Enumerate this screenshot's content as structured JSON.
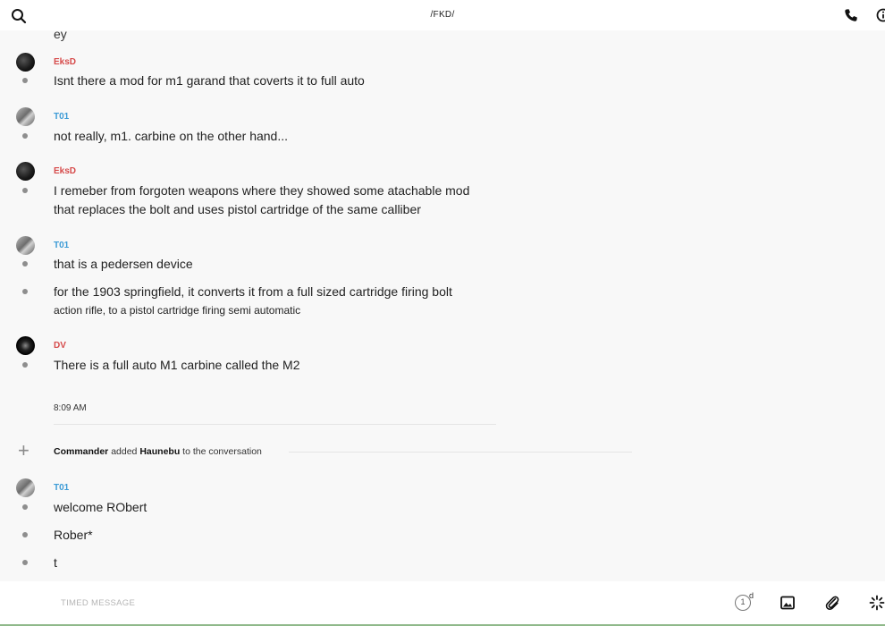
{
  "header": {
    "title": "/FKD/",
    "icons": [
      "search-icon",
      "phone-icon",
      "info-icon"
    ]
  },
  "messages": {
    "cut_top": "ey",
    "g1": {
      "sender": "EksD",
      "lines": [
        "Isnt there a mod for m1 garand that coverts it to full auto"
      ]
    },
    "g2": {
      "sender": "T01",
      "lines": [
        "not really, m1. carbine on the other hand..."
      ]
    },
    "g3": {
      "sender": "EksD",
      "lines": [
        "I remeber from forgoten weapons where they showed some atachable mod",
        "that replaces the bolt and uses pistol cartridge of the same calliber"
      ]
    },
    "g4": {
      "sender": "T01",
      "lines": [
        "that is a pedersen device",
        "for the 1903 springfield, it converts it from a full sized cartridge firing bolt",
        "action rifle, to a pistol cartridge firing semi automatic"
      ]
    },
    "g5": {
      "sender": "DV",
      "lines": [
        "There is a full auto M1 carbine called the M2"
      ]
    },
    "time": "8:09 AM",
    "system": {
      "actor": "Commander",
      "action": "added",
      "target": "Haunebu",
      "suffix": "to the conversation"
    },
    "g6": {
      "sender": "T01",
      "lines": [
        "welcome RObert",
        "Rober*",
        "t"
      ]
    }
  },
  "composer": {
    "placeholder": "TIMED MESSAGE",
    "timer_value": "1",
    "timer_unit": "d",
    "icons": [
      "timer-icon",
      "image-icon",
      "attachment-icon",
      "sparkle-icon"
    ]
  },
  "colors": {
    "sender_red": "#d64a4a",
    "sender_blue": "#3c9bd6",
    "background": "#f8f8f8"
  }
}
